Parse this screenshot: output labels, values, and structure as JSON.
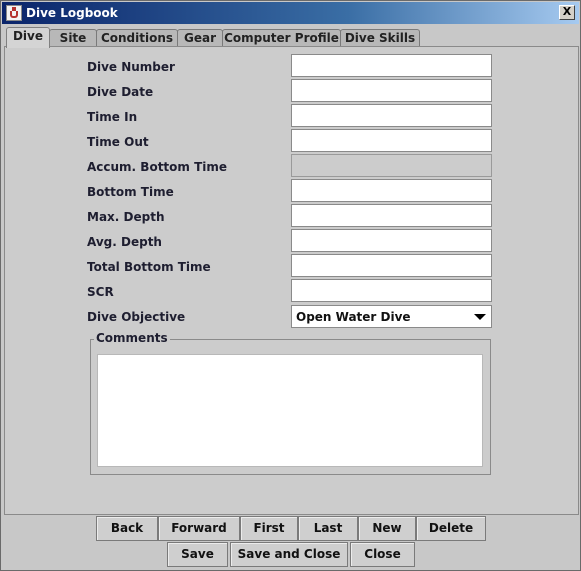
{
  "window": {
    "title": "Dive Logbook",
    "close_label": "X"
  },
  "tabs": [
    "Dive",
    "Site",
    "Conditions",
    "Gear",
    "Computer Profile",
    "Dive Skills"
  ],
  "form": {
    "dive_number": {
      "label": "Dive Number",
      "value": ""
    },
    "dive_date": {
      "label": "Dive Date",
      "value": ""
    },
    "time_in": {
      "label": "Time In",
      "value": ""
    },
    "time_out": {
      "label": "Time Out",
      "value": ""
    },
    "accum_bottom_time": {
      "label": "Accum. Bottom Time",
      "value": ""
    },
    "bottom_time": {
      "label": "Bottom Time",
      "value": ""
    },
    "max_depth": {
      "label": "Max. Depth",
      "value": ""
    },
    "avg_depth": {
      "label": "Avg. Depth",
      "value": ""
    },
    "total_bottom_time": {
      "label": "Total Bottom Time",
      "value": ""
    },
    "scr": {
      "label": "SCR",
      "value": ""
    },
    "dive_objective": {
      "label": "Dive Objective",
      "value": "Open Water Dive"
    }
  },
  "comments": {
    "label": "Comments",
    "value": ""
  },
  "nav_buttons": [
    "Back",
    "Forward",
    "First",
    "Last",
    "New",
    "Delete"
  ],
  "action_buttons": [
    "Save",
    "Save and Close",
    "Close"
  ]
}
